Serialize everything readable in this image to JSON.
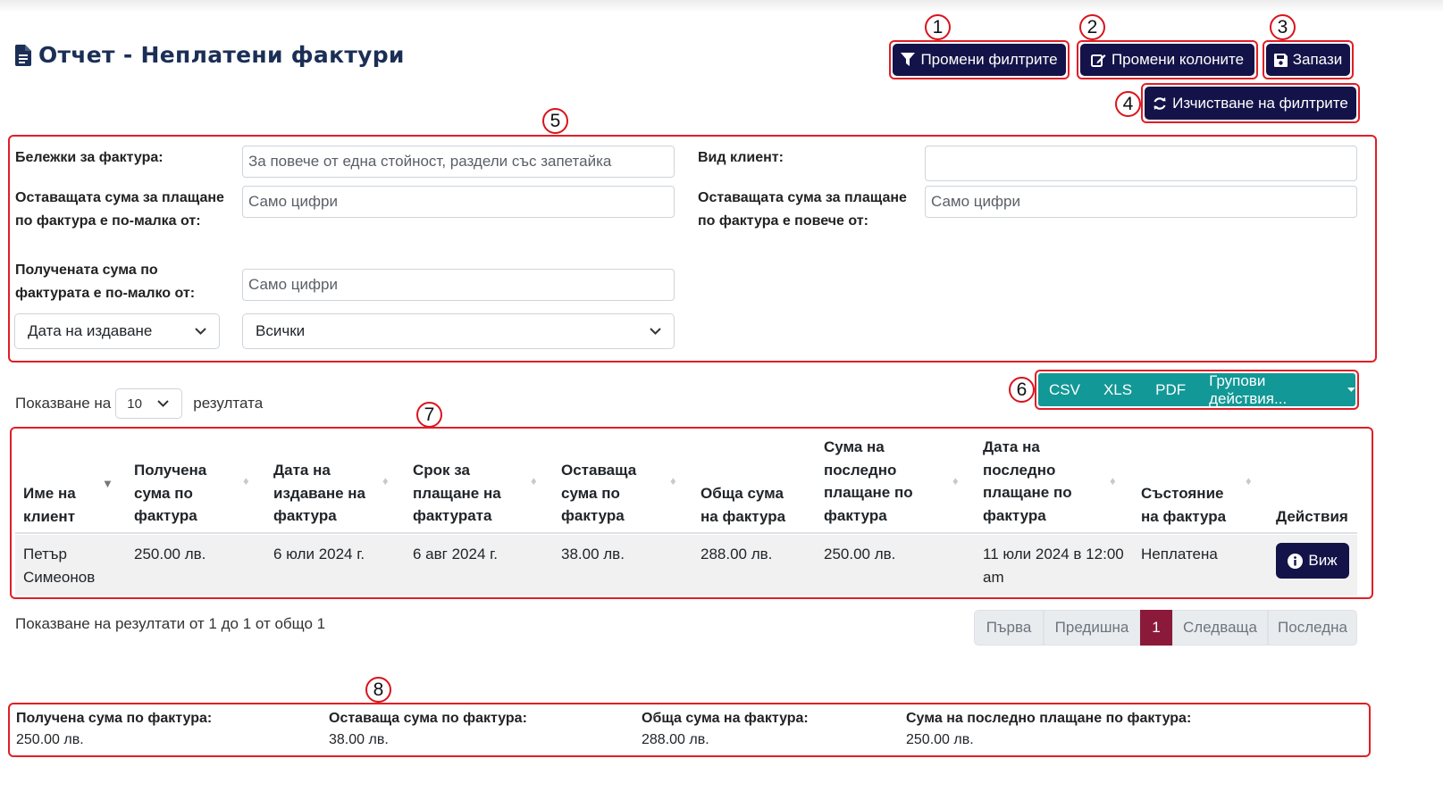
{
  "page": {
    "title": "Отчет - Неплатени фактури"
  },
  "toolbar": {
    "change_filters": "Промени филтрите",
    "change_columns": "Промени колоните",
    "save": "Запази",
    "clear_filters": "Изчистване на филтрите"
  },
  "markers": [
    "1",
    "2",
    "3",
    "4",
    "5",
    "6",
    "7",
    "8"
  ],
  "filters": {
    "invoice_notes_label": "Бележки за фактура:",
    "invoice_notes_placeholder": "За повече от една стойност, раздели със запетайка",
    "remaining_less_label": "Оставащата сума за плащане по фактура е по-малка от:",
    "remaining_less_placeholder": "Само цифри",
    "received_less_label": "Получената сума по фактурата е по-малко от:",
    "received_less_placeholder": "Само цифри",
    "date_type_value": "Дата на издаване",
    "date_range_value": "Всички",
    "client_type_label": "Вид клиент:",
    "client_type_value": "",
    "remaining_more_label": "Оставащата сума за плащане по фактура е повече от:",
    "remaining_more_placeholder": "Само цифри"
  },
  "export": {
    "csv": "CSV",
    "xls": "XLS",
    "pdf": "PDF",
    "bulk": "Групови действия..."
  },
  "length": {
    "prefix": "Показване на",
    "value": "10",
    "suffix": "резултата"
  },
  "table": {
    "headers": [
      "Име на клиент",
      "Получена сума по фактура",
      "Дата на издаване на фактура",
      "Срок за плащане на фактурата",
      "Оставаща сума по фактура",
      "Обща сума на фактура",
      "Сума на последно плащане по фактура",
      "Дата на последно плащане по фактура",
      "Състояние на фактура",
      "Действия"
    ],
    "rows": [
      {
        "client": "Петър Симеонов",
        "received": "250.00 лв.",
        "issued": "6 юли 2024 г.",
        "due": "6 авг 2024 г.",
        "remaining": "38.00 лв.",
        "total": "288.00 лв.",
        "last_payment": "250.00 лв.",
        "last_payment_date": "11 юли 2024 в 12:00 am",
        "status": "Неплатена",
        "action": "Виж"
      }
    ]
  },
  "info": "Показване на резултати от 1 до 1 от общо 1",
  "pagination": {
    "first": "Първа",
    "prev": "Предишна",
    "current": "1",
    "next": "Следваща",
    "last": "Последна"
  },
  "totals": [
    {
      "label": "Получена сума по фактура:",
      "value": "250.00 лв."
    },
    {
      "label": "Оставаща сума по фактура:",
      "value": "38.00 лв."
    },
    {
      "label": "Обща сума на фактура:",
      "value": "288.00 лв."
    },
    {
      "label": "Сума на последно плащане по фактура:",
      "value": "250.00 лв."
    }
  ],
  "colors": {
    "navy": "#141349",
    "teal": "#129896",
    "annotation_red": "#e01f26",
    "active_page": "#8b1a3a",
    "title": "#1b2f56"
  }
}
